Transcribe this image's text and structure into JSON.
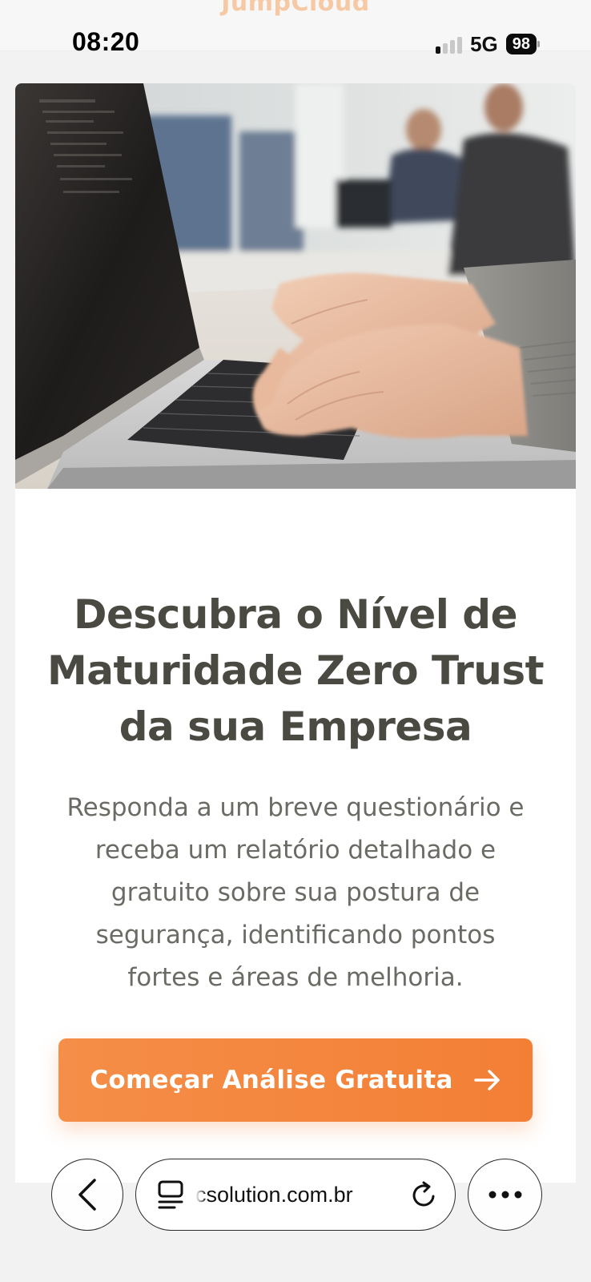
{
  "status_bar": {
    "time": "08:20",
    "network": "5G",
    "battery": "98",
    "signal_bars_active": 1,
    "signal_bars_total": 4
  },
  "page_behind": {
    "brand": "JumpCloud"
  },
  "hero": {
    "image": "photo of hands typing on a laptop in an office"
  },
  "content": {
    "headline": "Descubra o Nível de Maturidade Zero Trust da sua Empresa",
    "subtext": "Responda a um breve questionário e receba um relatório detalhado e gratuito sobre sua postura de segurança, identificando pontos fortes e áreas de melhoria.",
    "cta_label": "Começar Análise Gratuita",
    "cta_icon": "arrow-right-icon"
  },
  "browser": {
    "url": "csolution.com.br",
    "back_icon": "chevron-left-icon",
    "tabs_icon": "page-menu-icon",
    "reload_icon": "reload-icon",
    "more_icon": "ellipsis-icon"
  },
  "colors": {
    "accent": "#f37f35",
    "headline": "#4a4a42",
    "body_text": "#6b6b65"
  }
}
